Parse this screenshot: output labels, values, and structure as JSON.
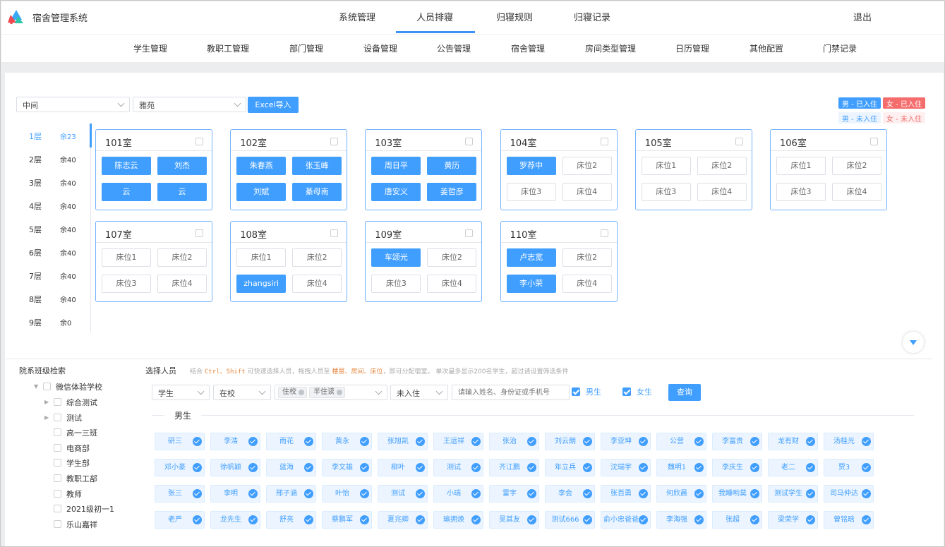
{
  "header": {
    "app_title": "宿舍管理系统",
    "nav": [
      "系统管理",
      "人员排寝",
      "归寝规则",
      "归寝记录"
    ],
    "active_nav": "人员排寝",
    "logout": "退出"
  },
  "subnav": [
    "学生管理",
    "教职工管理",
    "部门管理",
    "设备管理",
    "公告管理",
    "宿舍管理",
    "房间类型管理",
    "日历管理",
    "其他配置",
    "门禁记录"
  ],
  "filters": {
    "building_area": "中间",
    "building": "雅苑",
    "import_button": "Excel导入"
  },
  "legend": {
    "male_in": "男 - 已入住",
    "female_in": "女 - 已入住",
    "male_out": "男 - 未入住",
    "female_out": "女 - 未入住",
    "colors": {
      "male_in": "#409eff",
      "female_in": "#f56c6c",
      "male_out": "#ecf5ff",
      "female_out": "#fef0f0"
    }
  },
  "floors": [
    {
      "name": "1层",
      "remain": "余23"
    },
    {
      "name": "2层",
      "remain": "余40"
    },
    {
      "name": "3层",
      "remain": "余40"
    },
    {
      "name": "4层",
      "remain": "余40"
    },
    {
      "name": "5层",
      "remain": "余40"
    },
    {
      "name": "6层",
      "remain": "余40"
    },
    {
      "name": "7层",
      "remain": "余40"
    },
    {
      "name": "8层",
      "remain": "余40"
    },
    {
      "name": "9层",
      "remain": "余0"
    }
  ],
  "rooms": [
    {
      "name": "101室",
      "beds": [
        {
          "label": "陈志云",
          "filled": true
        },
        {
          "label": "刘杰",
          "filled": true
        },
        {
          "label": "云",
          "filled": true
        },
        {
          "label": "云",
          "filled": true
        }
      ]
    },
    {
      "name": "102室",
      "beds": [
        {
          "label": "朱春燕",
          "filled": true
        },
        {
          "label": "张玉峰",
          "filled": true
        },
        {
          "label": "刘斌",
          "filled": true
        },
        {
          "label": "綦母南",
          "filled": true
        }
      ]
    },
    {
      "name": "103室",
      "beds": [
        {
          "label": "周日平",
          "filled": true
        },
        {
          "label": "黄历",
          "filled": true
        },
        {
          "label": "唐安义",
          "filled": true
        },
        {
          "label": "姜哲彦",
          "filled": true
        }
      ]
    },
    {
      "name": "104室",
      "beds": [
        {
          "label": "罗荐中",
          "filled": true
        },
        {
          "label": "床位2",
          "filled": false
        },
        {
          "label": "床位3",
          "filled": false
        },
        {
          "label": "床位4",
          "filled": false
        }
      ]
    },
    {
      "name": "105室",
      "beds": [
        {
          "label": "床位1",
          "filled": false
        },
        {
          "label": "床位2",
          "filled": false
        },
        {
          "label": "床位3",
          "filled": false
        },
        {
          "label": "床位4",
          "filled": false
        }
      ]
    },
    {
      "name": "106室",
      "beds": [
        {
          "label": "床位1",
          "filled": false
        },
        {
          "label": "床位2",
          "filled": false
        },
        {
          "label": "床位3",
          "filled": false
        },
        {
          "label": "床位4",
          "filled": false
        }
      ]
    },
    {
      "name": "107室",
      "beds": [
        {
          "label": "床位1",
          "filled": false
        },
        {
          "label": "床位2",
          "filled": false
        },
        {
          "label": "床位3",
          "filled": false
        },
        {
          "label": "床位4",
          "filled": false
        }
      ]
    },
    {
      "name": "108室",
      "beds": [
        {
          "label": "床位1",
          "filled": false
        },
        {
          "label": "床位2",
          "filled": false
        },
        {
          "label": "zhangsiri",
          "filled": true
        },
        {
          "label": "床位4",
          "filled": false
        }
      ]
    },
    {
      "name": "109室",
      "beds": [
        {
          "label": "车颂光",
          "filled": true
        },
        {
          "label": "床位2",
          "filled": false
        },
        {
          "label": "床位3",
          "filled": false
        },
        {
          "label": "床位4",
          "filled": false
        }
      ]
    },
    {
      "name": "110室",
      "beds": [
        {
          "label": "卢志宽",
          "filled": true
        },
        {
          "label": "床位2",
          "filled": false
        },
        {
          "label": "李小荣",
          "filled": true
        },
        {
          "label": "床位4",
          "filled": false
        }
      ]
    }
  ],
  "tree": {
    "title": "院系班级检索",
    "root": "微信体验学校",
    "children": [
      "综合测试",
      "测试",
      "高一三班",
      "电商部",
      "学生部",
      "教职工部",
      "教师",
      "2021级初一1",
      "乐山嘉祥"
    ]
  },
  "picker": {
    "title": "选择人员",
    "hint_prefix": "结合",
    "hint_keys": "Ctrl、Shift",
    "hint_mid": "可快速选择人员，拖拽人员至",
    "hint_targets": "楼层、房间、床位",
    "hint_suffix": "，即可分配宿室。 单次最多显示200名学生，超过请设置筛选条件",
    "type_select": "学生",
    "status_select": "在校",
    "tags": [
      "住校",
      "半住读"
    ],
    "checkin_select": "未入住",
    "search_placeholder": "请输入姓名、身份证或手机号",
    "male_check": "男生",
    "female_check": "女生",
    "query_button": "查询",
    "section_label": "男生",
    "students": [
      "研三",
      "李浩",
      "雨花",
      "黄永",
      "张旭凯",
      "王运祥",
      "张治",
      "刘云朗",
      "李亚坤",
      "公营",
      "李富贵",
      "龙有财",
      "汤桂光",
      "邓小豪",
      "徐帆颖",
      "蓝海",
      "李文雄",
      "柳叶",
      "测试",
      "齐江鹏",
      "年立兵",
      "沈瑞宇",
      "魏明1",
      "李庆生",
      "老二",
      "贾3",
      "张三",
      "李明",
      "邢子涵",
      "叶怡",
      "测试",
      "小瑞",
      "雷宇",
      "李会",
      "张百勇",
      "何欣晨",
      "我睡哟莫",
      "测试学生",
      "司马仲达",
      "老严",
      "龙先生",
      "舒亮",
      "蔡鹏军",
      "夏兆卿",
      "瑜拥焕",
      "吴其友",
      "测试666",
      "俞小忠爸爸",
      "李海强",
      "张超",
      "梁荣学",
      "曾铭晗"
    ]
  }
}
